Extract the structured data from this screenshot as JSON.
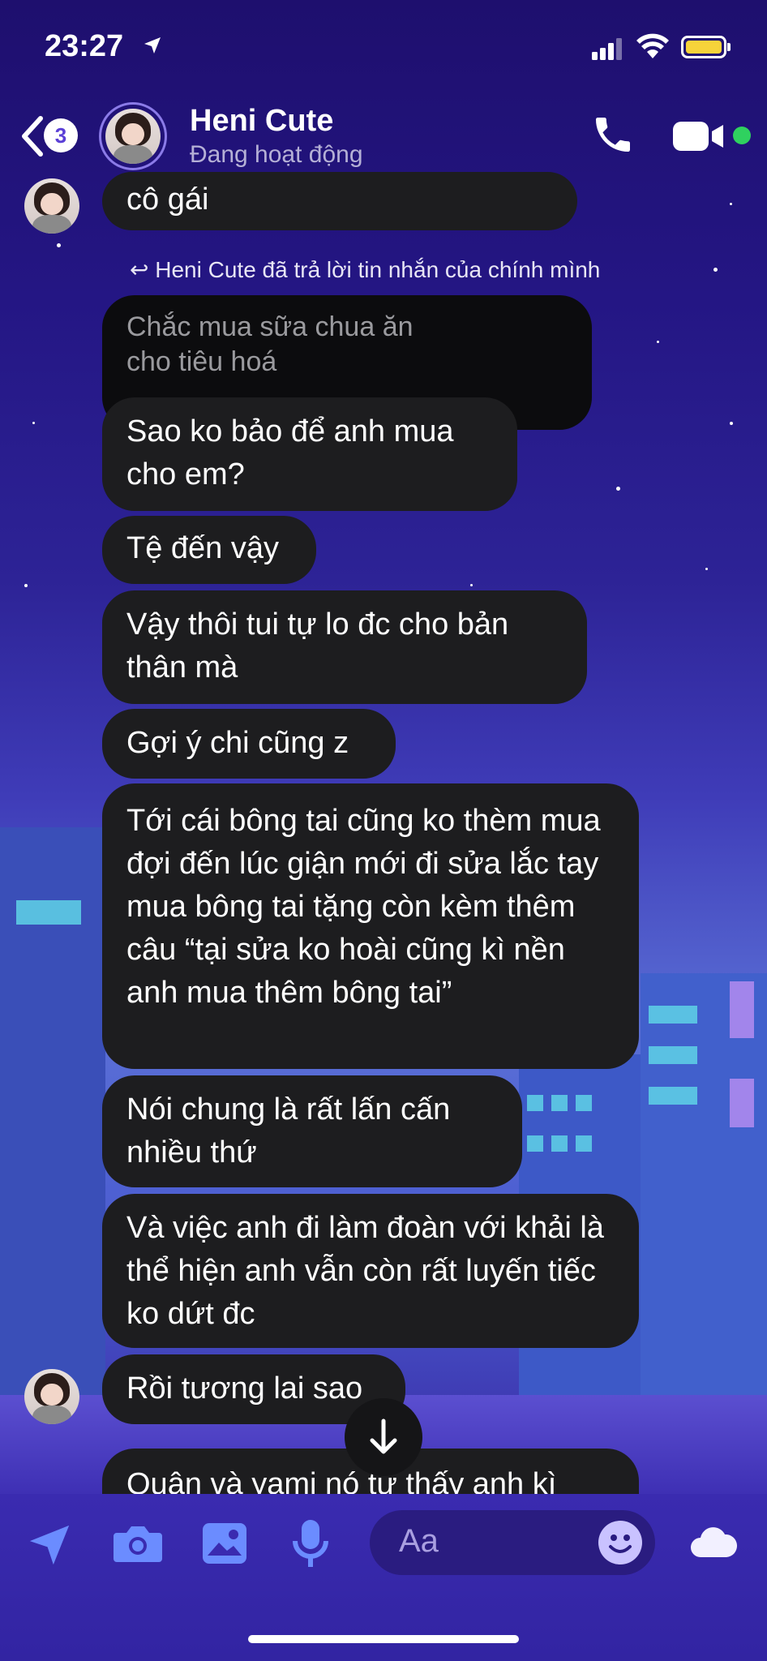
{
  "status_bar": {
    "time": "23:27"
  },
  "header": {
    "unread_badge": "3",
    "contact_name": "Heni Cute",
    "contact_status": "Đang hoạt động"
  },
  "chat": {
    "top_partial_message": "cô gái",
    "reply_note": "Heni Cute đã trả lời tin nhắn của chính mình",
    "quoted_message": "Chắc mua sữa chua ăn cho tiêu hoá",
    "messages": [
      "Sao ko bảo để anh mua cho em?",
      "Tệ đến vậy",
      "Vậy thôi tui tự lo đc cho bản thân mà",
      "Gợi ý chi cũng z",
      "Tới cái bông tai cũng ko thèm mua đợi đến lúc giận mới đi sửa lắc tay mua bông tai tặng còn kèm thêm câu “tại sửa ko hoài cũng kì nền anh mua thêm bông tai”",
      "Nói chung là rất lấn cấn nhiều thứ",
      "Và việc anh đi làm đoàn với khải là thể hiện anh vẫn còn rất luyến tiếc ko dứt đc",
      "Rồi tương lai sao",
      "Quân và yami nó tự thấy anh kì"
    ]
  },
  "composer": {
    "placeholder": "Aa"
  },
  "colors": {
    "accent": "#5a3fd6",
    "bubble": "#1d1d1f",
    "online": "#2fd15f"
  }
}
